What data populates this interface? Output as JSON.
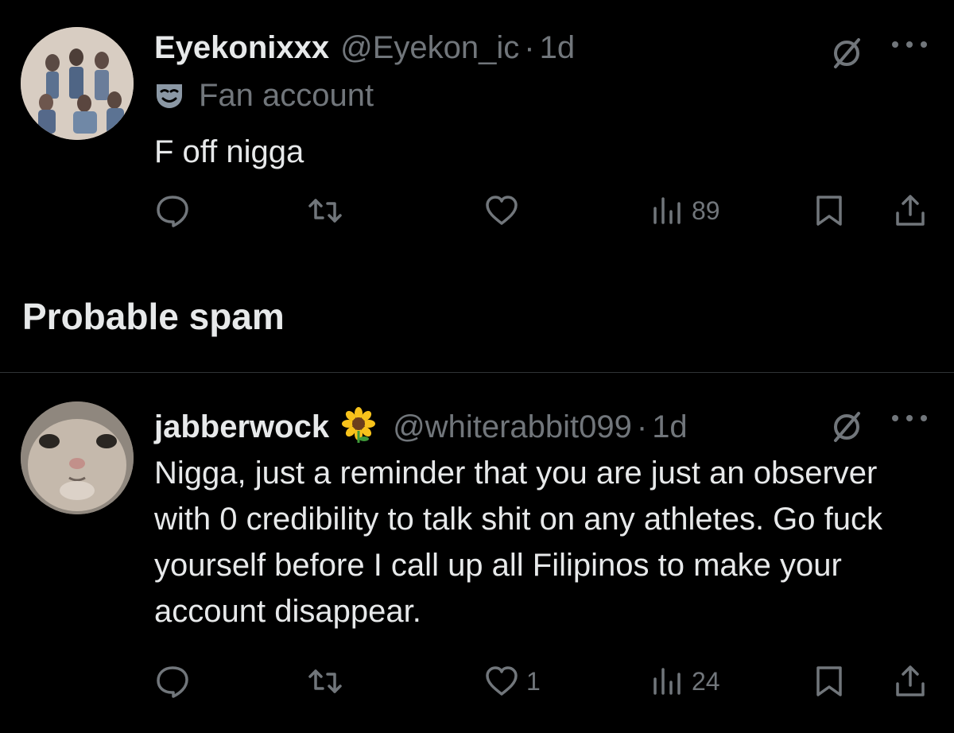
{
  "tweets": [
    {
      "name": "Eyekonixxx",
      "handle": "@Eyekon_ic",
      "separator": "·",
      "age": "1d",
      "label": "Fan account",
      "text": "F off nigga",
      "counts": {
        "reply": "",
        "retweet": "",
        "like": "",
        "views": "89"
      }
    },
    {
      "name": "jabberwock",
      "badge_emoji": "🌻",
      "handle": "@whiterabbit099",
      "separator": "·",
      "age": "1d",
      "text": "Nigga, just a reminder that you are just an observer with 0 credibility to talk shit on any athletes. Go fuck yourself before I call up all Filipinos to make your account disappear.",
      "counts": {
        "reply": "",
        "retweet": "",
        "like": "1",
        "views": "24"
      }
    }
  ],
  "section": {
    "title": "Probable spam"
  },
  "colors": {
    "background": "#000000",
    "text": "#e7e9ea",
    "muted": "#71767b",
    "divider": "#2f3336"
  },
  "icons": [
    "grok-icon",
    "more-icon",
    "mask-icon",
    "reply-icon",
    "retweet-icon",
    "like-icon",
    "views-icon",
    "bookmark-icon",
    "share-icon"
  ]
}
